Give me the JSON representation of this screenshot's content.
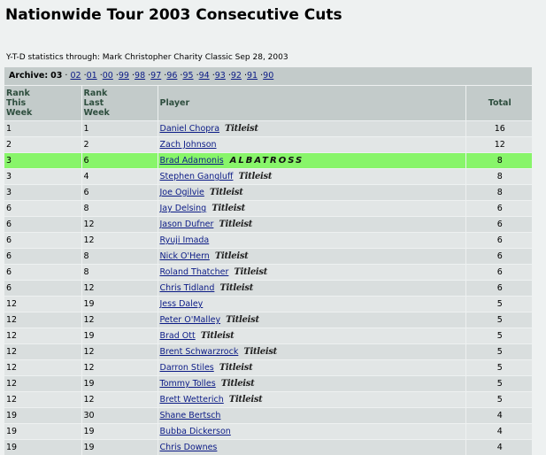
{
  "page": {
    "title": "Nationwide Tour 2003 Consecutive Cuts",
    "ytd": "Y-T-D statistics through: Mark Christopher Charity Classic Sep 28, 2003"
  },
  "archive": {
    "label": "Archive:",
    "current": "03",
    "years": [
      "02",
      "01",
      "00",
      "99",
      "98",
      "97",
      "96",
      "95",
      "94",
      "93",
      "92",
      "91",
      "90"
    ]
  },
  "table": {
    "headers": {
      "rank_this_week": [
        "Rank",
        "This",
        "Week"
      ],
      "rank_last_week": [
        "Rank",
        "Last",
        "Week"
      ],
      "player": "Player",
      "total": "Total"
    },
    "rows": [
      {
        "rank": "1",
        "last": "1",
        "player": "Daniel Chopra",
        "sponsor": "Titleist",
        "total": "16"
      },
      {
        "rank": "2",
        "last": "2",
        "player": "Zach Johnson",
        "sponsor": "",
        "total": "12"
      },
      {
        "rank": "3",
        "last": "6",
        "player": "Brad Adamonis",
        "sponsor": "ALBATROSS",
        "total": "8",
        "highlight": true
      },
      {
        "rank": "3",
        "last": "4",
        "player": "Stephen Gangluff",
        "sponsor": "Titleist",
        "total": "8"
      },
      {
        "rank": "3",
        "last": "6",
        "player": "Joe Ogilvie",
        "sponsor": "Titleist",
        "total": "8"
      },
      {
        "rank": "6",
        "last": "8",
        "player": "Jay Delsing",
        "sponsor": "Titleist",
        "total": "6"
      },
      {
        "rank": "6",
        "last": "12",
        "player": "Jason Dufner",
        "sponsor": "Titleist",
        "total": "6"
      },
      {
        "rank": "6",
        "last": "12",
        "player": "Ryuji Imada",
        "sponsor": "",
        "total": "6"
      },
      {
        "rank": "6",
        "last": "8",
        "player": "Nick O'Hern",
        "sponsor": "Titleist",
        "total": "6"
      },
      {
        "rank": "6",
        "last": "8",
        "player": "Roland Thatcher",
        "sponsor": "Titleist",
        "total": "6"
      },
      {
        "rank": "6",
        "last": "12",
        "player": "Chris Tidland",
        "sponsor": "Titleist",
        "total": "6"
      },
      {
        "rank": "12",
        "last": "19",
        "player": "Jess Daley",
        "sponsor": "",
        "total": "5"
      },
      {
        "rank": "12",
        "last": "12",
        "player": "Peter O'Malley",
        "sponsor": "Titleist",
        "total": "5"
      },
      {
        "rank": "12",
        "last": "19",
        "player": "Brad Ott",
        "sponsor": "Titleist",
        "total": "5"
      },
      {
        "rank": "12",
        "last": "12",
        "player": "Brent Schwarzrock",
        "sponsor": "Titleist",
        "total": "5"
      },
      {
        "rank": "12",
        "last": "12",
        "player": "Darron Stiles",
        "sponsor": "Titleist",
        "total": "5"
      },
      {
        "rank": "12",
        "last": "19",
        "player": "Tommy Tolles",
        "sponsor": "Titleist",
        "total": "5"
      },
      {
        "rank": "12",
        "last": "12",
        "player": "Brett Wetterich",
        "sponsor": "Titleist",
        "total": "5"
      },
      {
        "rank": "19",
        "last": "30",
        "player": "Shane Bertsch",
        "sponsor": "",
        "total": "4"
      },
      {
        "rank": "19",
        "last": "19",
        "player": "Bubba Dickerson",
        "sponsor": "",
        "total": "4"
      },
      {
        "rank": "19",
        "last": "19",
        "player": "Chris Downes",
        "sponsor": "",
        "total": "4"
      }
    ]
  },
  "colors": {
    "highlight_row": "#88f56a",
    "header_bg": "#c3cbca",
    "header_text": "#2e4e3e",
    "link": "#0b1b86"
  }
}
